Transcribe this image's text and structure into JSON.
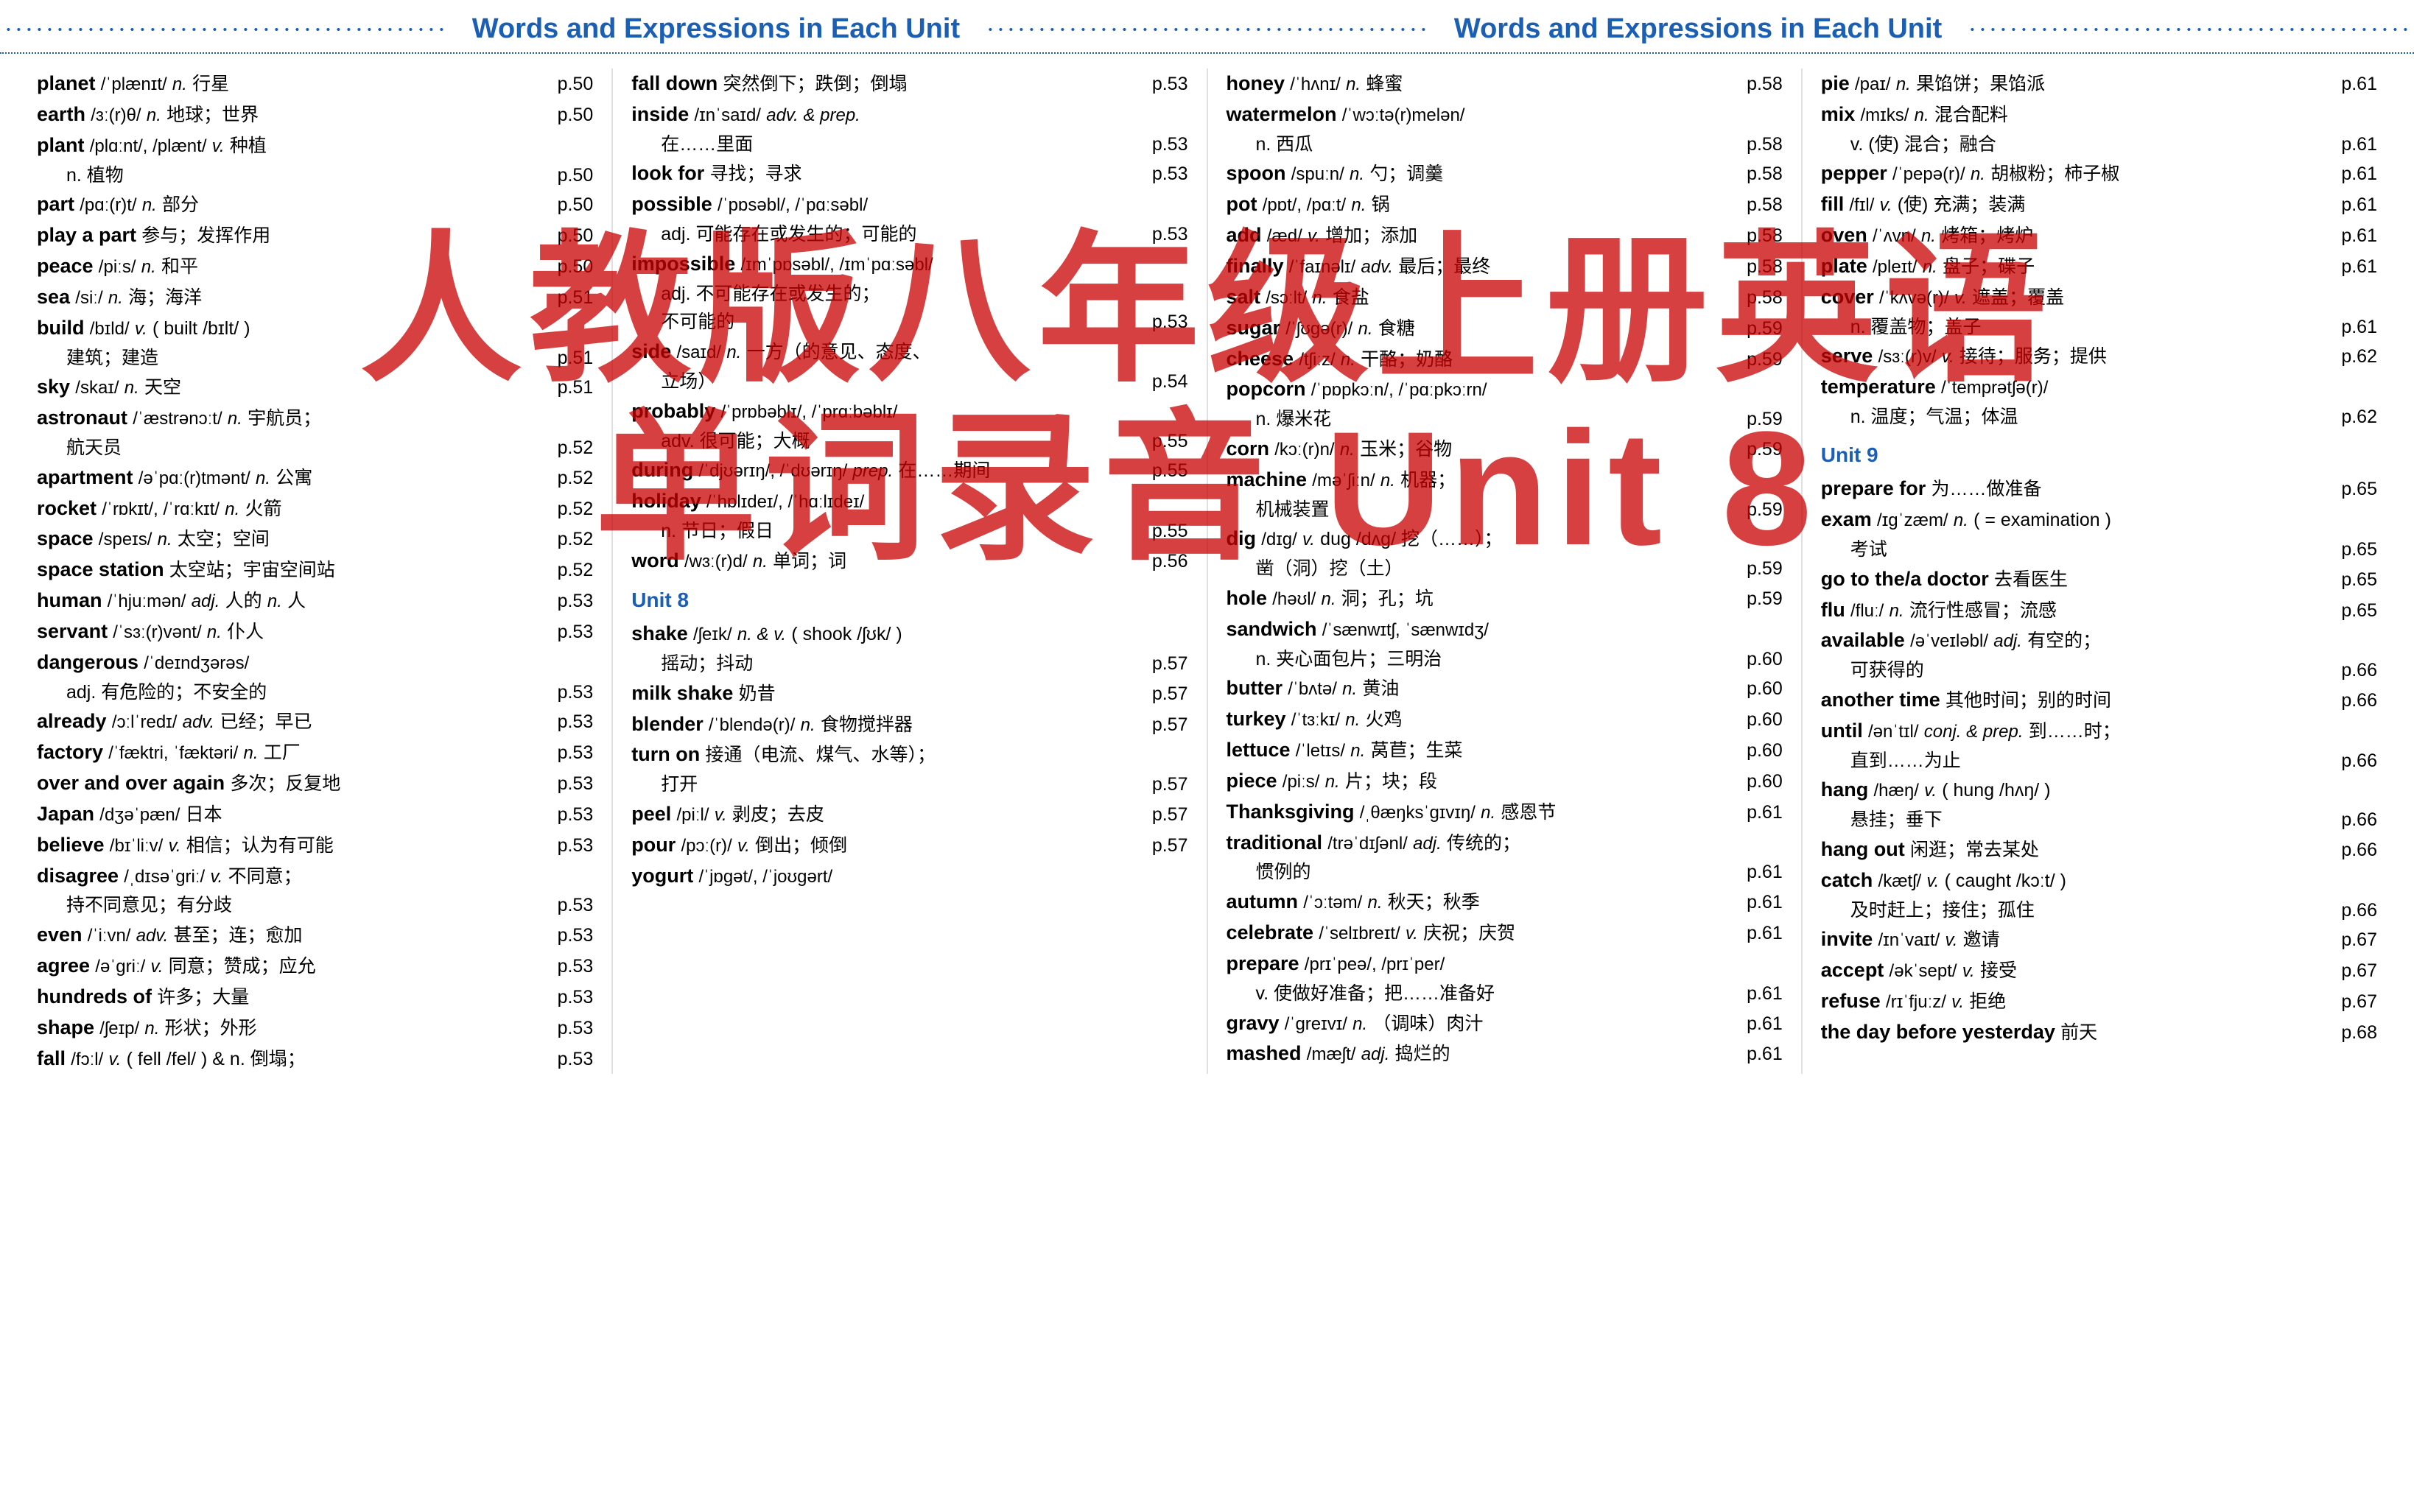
{
  "header": {
    "title": "Words and Expressions in Each Unit",
    "title2": "Words and Expressions in Each Unit"
  },
  "watermark": {
    "lines": [
      "人教版八年级上册英语",
      "单词录音 Unit 8"
    ]
  },
  "left_column": {
    "entries": [
      {
        "word": "planet",
        "phonetic": "/ˈplænɪt/",
        "pos": "n.",
        "meaning": "行星",
        "page": "p.50"
      },
      {
        "word": "earth",
        "phonetic": "/ɜː(r)θ/",
        "pos": "n.",
        "meaning": "地球；世界",
        "page": "p.50"
      },
      {
        "word": "plant",
        "phonetic": "/plɑːnt/, /plænt/",
        "pos": "v.",
        "meaning": "种植",
        "page": ""
      },
      {
        "indent": "n. 植物",
        "page": "p.50"
      },
      {
        "word": "part",
        "phonetic": "/pɑː(r)t/",
        "pos": "n.",
        "meaning": "部分",
        "page": "p.50"
      },
      {
        "word": "play a part",
        "meaning": "参与；发挥作用",
        "page": "p.50"
      },
      {
        "word": "peace",
        "phonetic": "/piːs/",
        "pos": "n.",
        "meaning": "和平",
        "page": "p.50"
      },
      {
        "word": "sea",
        "phonetic": "/siː/",
        "pos": "n.",
        "meaning": "海；海洋",
        "page": "p.51"
      },
      {
        "word": "build",
        "phonetic": "/bɪld/",
        "pos": "v.",
        "meaning": "( built /bɪlt/ )",
        "page": ""
      },
      {
        "indent": "建筑；建造",
        "page": "p.51"
      },
      {
        "word": "sky",
        "phonetic": "/skaɪ/",
        "pos": "n.",
        "meaning": "天空",
        "page": "p.51"
      },
      {
        "word": "astronaut",
        "phonetic": "/ˈæstrənɔːt/",
        "pos": "n.",
        "meaning": "宇航员；",
        "page": ""
      },
      {
        "indent": "航天员",
        "page": "p.52"
      },
      {
        "word": "apartment",
        "phonetic": "/əˈpɑː(r)tmənt/",
        "pos": "n.",
        "meaning": "公寓",
        "page": "p.52"
      },
      {
        "word": "rocket",
        "phonetic": "/ˈrɒkɪt/, /ˈrɑːkɪt/",
        "pos": "n.",
        "meaning": "火箭",
        "page": "p.52"
      },
      {
        "word": "space",
        "phonetic": "/speɪs/",
        "pos": "n.",
        "meaning": "太空；空间",
        "page": "p.52"
      },
      {
        "word": "space station",
        "meaning": "太空站；宇宙空间站",
        "page": "p.52"
      },
      {
        "word": "human",
        "phonetic": "/ˈhjuːmən/",
        "pos": "adj.",
        "meaning": "人的",
        "pos2": "n.",
        "meaning2": "人",
        "page": "p.53"
      },
      {
        "word": "servant",
        "phonetic": "/ˈsɜː(r)vənt/",
        "pos": "n.",
        "meaning": "仆人",
        "page": "p.53"
      },
      {
        "word": "dangerous",
        "phonetic": "/ˈdeɪndʒərəs/",
        "page": ""
      },
      {
        "indent": "adj. 有危险的；不安全的",
        "page": "p.53"
      },
      {
        "word": "already",
        "phonetic": "/ɔːlˈredɪ/",
        "pos": "adv.",
        "meaning": "已经；早已",
        "page": "p.53"
      },
      {
        "word": "factory",
        "phonetic": "/ˈfæktri, ˈfæktəri/",
        "pos": "n.",
        "meaning": "工厂",
        "page": "p.53"
      },
      {
        "word": "over and over again",
        "meaning": "多次；反复地",
        "page": "p.53"
      },
      {
        "word": "Japan",
        "phonetic": "/dʒəˈpæn/",
        "meaning": "日本",
        "page": "p.53"
      },
      {
        "word": "believe",
        "phonetic": "/bɪˈliːv/",
        "pos": "v.",
        "meaning": "相信；认为有可能",
        "page": "p.53"
      },
      {
        "word": "disagree",
        "phonetic": "/ˌdɪsəˈɡriː/",
        "pos": "v.",
        "meaning": "不同意；",
        "page": ""
      },
      {
        "indent": "持不同意见；有分歧",
        "page": "p.53"
      },
      {
        "word": "even",
        "phonetic": "/ˈiːvn/",
        "pos": "adv.",
        "meaning": "甚至；连；愈加",
        "page": "p.53"
      },
      {
        "word": "agree",
        "phonetic": "/əˈɡriː/",
        "pos": "v.",
        "meaning": "同意；赞成；应允",
        "page": "p.53"
      },
      {
        "word": "hundreds of",
        "meaning": "许多；大量",
        "page": "p.53"
      },
      {
        "word": "shape",
        "phonetic": "/ʃeɪp/",
        "pos": "n.",
        "meaning": "形状；外形",
        "page": "p.53"
      },
      {
        "word": "fall",
        "phonetic": "/fɔːl/",
        "pos": "v.",
        "meaning": "( fell /fel/ ) & n. 倒塌；",
        "page": "p.53"
      }
    ]
  },
  "middle_column": {
    "entries": [
      {
        "word": "fall down",
        "meaning": "突然倒下；跌倒；倒塌",
        "page": "p.53"
      },
      {
        "word": "inside",
        "phonetic": "/ɪnˈsaɪd/",
        "pos": "adv. & prep.",
        "page": ""
      },
      {
        "indent": "在……里面",
        "page": "p.53"
      },
      {
        "word": "look for",
        "meaning": "寻找；寻求",
        "page": "p.53"
      },
      {
        "word": "possible",
        "phonetic": "/ˈpɒsəbl/, /ˈpɑːsəbl/",
        "page": ""
      },
      {
        "indent": "adj. 可能存在或发生的；可能的",
        "page": "p.53"
      },
      {
        "word": "impossible",
        "phonetic": "/ɪmˈpɒsəbl/, /ɪmˈpɑːsəbl/",
        "page": ""
      },
      {
        "indent": "adj. 不可能存在或发生的；",
        "page": ""
      },
      {
        "indent": "不可能的",
        "page": "p.53"
      },
      {
        "word": "side",
        "phonetic": "/saɪd/",
        "pos": "n.",
        "meaning": "一方（的意见、态度、",
        "page": ""
      },
      {
        "indent": "立场）",
        "page": "p.54"
      },
      {
        "word": "probably",
        "phonetic": "/ˈprɒbəblɪ/, /ˈprɑːbəblɪ/",
        "page": ""
      },
      {
        "indent": "adv. 很可能；大概",
        "page": "p.55"
      },
      {
        "word": "during",
        "phonetic": "/ˈdjʊərɪŋ/, /ˈdʊərɪŋ/",
        "pos": "prep.",
        "meaning": "在……期间",
        "page": "p.55"
      },
      {
        "word": "holiday",
        "phonetic": "/ˈhɒlɪdeɪ/, /ˈhɑːlɪdeɪ/",
        "page": ""
      },
      {
        "indent": "n. 节日；假日",
        "page": "p.55"
      },
      {
        "word": "word",
        "phonetic": "/wɜː(r)d/",
        "pos": "n.",
        "meaning": "单词；词",
        "page": "p.56"
      },
      {
        "unit": "Unit 8"
      },
      {
        "word": "shake",
        "phonetic": "/ʃeɪk/",
        "pos": "n. & v.",
        "meaning": "( shook /ʃʊk/ )",
        "page": ""
      },
      {
        "indent": "摇动；抖动",
        "page": "p.57"
      },
      {
        "word": "milk shake",
        "meaning": "奶昔",
        "page": "p.57"
      },
      {
        "word": "blender",
        "phonetic": "/ˈblendə(r)/",
        "pos": "n.",
        "meaning": "食物搅拌器",
        "page": "p.57"
      },
      {
        "word": "turn on",
        "meaning": "接通（电流、煤气、水等）；",
        "page": ""
      },
      {
        "indent": "打开",
        "page": "p.57"
      },
      {
        "word": "peel",
        "phonetic": "/piːl/",
        "pos": "v.",
        "meaning": "剥皮；去皮",
        "page": "p.57"
      },
      {
        "word": "pour",
        "phonetic": "/pɔː(r)/",
        "pos": "v.",
        "meaning": "倒出；倾倒",
        "page": "p.57"
      },
      {
        "word": "yogurt",
        "phonetic": "/ˈjɒɡət/, /ˈjoʊɡərt/",
        "page": ""
      }
    ]
  },
  "right_column1": {
    "entries": [
      {
        "word": "honey",
        "phonetic": "/ˈhʌnɪ/",
        "pos": "n.",
        "meaning": "蜂蜜",
        "page": "p.58"
      },
      {
        "word": "watermelon",
        "phonetic": "/ˈwɔːtə(r)melən/",
        "page": ""
      },
      {
        "indent": "n. 西瓜",
        "page": "p.58"
      },
      {
        "word": "spoon",
        "phonetic": "/spuːn/",
        "pos": "n.",
        "meaning": "勺；调羹",
        "page": "p.58"
      },
      {
        "word": "pot",
        "phonetic": "/pɒt/, /pɑːt/",
        "pos": "n.",
        "meaning": "锅",
        "page": "p.58"
      },
      {
        "word": "add",
        "phonetic": "/æd/",
        "pos": "v.",
        "meaning": "增加；添加",
        "page": "p.58"
      },
      {
        "word": "finally",
        "phonetic": "/ˈfaɪnəlɪ/",
        "pos": "adv.",
        "meaning": "最后；最终",
        "page": "p.58"
      },
      {
        "word": "salt",
        "phonetic": "/sɔːlt/",
        "pos": "n.",
        "meaning": "食盐",
        "page": "p.58"
      },
      {
        "word": "sugar",
        "phonetic": "/ˈʃʊɡə(r)/",
        "pos": "n.",
        "meaning": "食糖",
        "page": "p.59"
      },
      {
        "word": "cheese",
        "phonetic": "/tʃiːz/",
        "pos": "n.",
        "meaning": "干酪；奶酪",
        "page": "p.59"
      },
      {
        "word": "popcorn",
        "phonetic": "/ˈpɒpkɔːn/, /ˈpɑːpkɔːrn/",
        "page": ""
      },
      {
        "indent": "n. 爆米花",
        "page": "p.59"
      },
      {
        "word": "corn",
        "phonetic": "/kɔː(r)n/",
        "pos": "n.",
        "meaning": "玉米；谷物",
        "page": "p.59"
      },
      {
        "word": "machine",
        "phonetic": "/məˈʃiːn/",
        "pos": "n.",
        "meaning": "机器；",
        "page": ""
      },
      {
        "indent": "机械装置",
        "page": "p.59"
      },
      {
        "word": "dig",
        "phonetic": "/dɪɡ/",
        "pos": "v.",
        "meaning": "dug /dʌɡ/  挖（……）；",
        "page": ""
      },
      {
        "indent": "凿（洞）挖（土）",
        "page": "p.59"
      },
      {
        "word": "hole",
        "phonetic": "/həʊl/",
        "pos": "n.",
        "meaning": "洞；孔；坑",
        "page": "p.59"
      },
      {
        "word": "sandwich",
        "phonetic": "/ˈsænwɪtʃ, ˈsænwɪdʒ/",
        "page": ""
      },
      {
        "indent": "n. 夹心面包片；三明治",
        "page": "p.60"
      },
      {
        "word": "butter",
        "phonetic": "/ˈbʌtə/",
        "pos": "n.",
        "meaning": "黄油",
        "page": "p.60"
      },
      {
        "word": "turkey",
        "phonetic": "/ˈtɜːkɪ/",
        "pos": "n.",
        "meaning": "火鸡",
        "page": "p.60"
      },
      {
        "word": "lettuce",
        "phonetic": "/ˈletɪs/",
        "pos": "n.",
        "meaning": "莴苣；生菜",
        "page": "p.60"
      },
      {
        "word": "piece",
        "phonetic": "/piːs/",
        "pos": "n.",
        "meaning": "片；块；段",
        "page": "p.60"
      },
      {
        "word": "Thanksgiving",
        "phonetic": "/ˌθæŋksˈɡɪvɪŋ/",
        "pos": "n.",
        "meaning": "感恩节",
        "page": "p.61"
      },
      {
        "word": "traditional",
        "phonetic": "/trəˈdɪʃənl/",
        "pos": "adj.",
        "meaning": "传统的；",
        "page": ""
      },
      {
        "indent": "惯例的",
        "page": "p.61"
      },
      {
        "word": "autumn",
        "phonetic": "/ˈɔːtəm/",
        "pos": "n.",
        "meaning": "秋天；秋季",
        "page": "p.61"
      },
      {
        "word": "celebrate",
        "phonetic": "/ˈselɪbreɪt/",
        "pos": "v.",
        "meaning": "庆祝；庆贺",
        "page": "p.61"
      },
      {
        "word": "prepare",
        "phonetic": "/prɪˈpeə/, /prɪˈper/",
        "page": ""
      },
      {
        "indent": "v. 使做好准备；把……准备好",
        "page": "p.61"
      },
      {
        "word": "gravy",
        "phonetic": "/ˈɡreɪvɪ/",
        "pos": "n.",
        "meaning": "（调味）肉汁",
        "page": "p.61"
      },
      {
        "word": "mashed",
        "phonetic": "/mæʃt/",
        "pos": "adj.",
        "meaning": "捣烂的",
        "page": "p.61"
      }
    ]
  },
  "right_column2": {
    "entries": [
      {
        "word": "pie",
        "phonetic": "/paɪ/",
        "pos": "n.",
        "meaning": "果馅饼；果馅派",
        "page": "p.61"
      },
      {
        "word": "mix",
        "phonetic": "/mɪks/",
        "pos": "n.",
        "meaning": "混合配料",
        "page": ""
      },
      {
        "indent": "v. (使) 混合；融合",
        "page": "p.61"
      },
      {
        "word": "pepper",
        "phonetic": "/ˈpepə(r)/",
        "pos": "n.",
        "meaning": "胡椒粉；柿子椒",
        "page": "p.61"
      },
      {
        "word": "fill",
        "phonetic": "/fɪl/",
        "pos": "v.",
        "meaning": "(使) 充满；装满",
        "page": "p.61"
      },
      {
        "word": "oven",
        "phonetic": "/ˈʌvn/",
        "pos": "n.",
        "meaning": "烤箱；烤炉",
        "page": "p.61"
      },
      {
        "word": "plate",
        "phonetic": "/pleɪt/",
        "pos": "n.",
        "meaning": "盘子；碟子",
        "page": "p.61"
      },
      {
        "word": "cover",
        "phonetic": "/ˈkʌvə(r)/",
        "pos": "v.",
        "meaning": "遮盖；覆盖",
        "page": ""
      },
      {
        "indent": "n. 覆盖物；盖子",
        "page": "p.61"
      },
      {
        "word": "serve",
        "phonetic": "/sɜː(r)v/",
        "pos": "v.",
        "meaning": "接待；服务；提供",
        "page": "p.62"
      },
      {
        "word": "temperature",
        "phonetic": "/ˈtemprətʃə(r)/",
        "page": ""
      },
      {
        "indent": "n. 温度；气温；体温",
        "page": "p.62"
      },
      {
        "unit": "Unit 9"
      },
      {
        "word": "prepare for",
        "meaning": "为……做准备",
        "page": "p.65"
      },
      {
        "word": "exam",
        "phonetic": "/ɪɡˈzæm/",
        "pos": "n.",
        "meaning": "( = examination )",
        "page": ""
      },
      {
        "indent": "考试",
        "page": "p.65"
      },
      {
        "word": "go to the/a doctor",
        "meaning": "去看医生",
        "page": "p.65"
      },
      {
        "word": "flu",
        "phonetic": "/fluː/",
        "pos": "n.",
        "meaning": "流行性感冒；流感",
        "page": "p.65"
      },
      {
        "word": "available",
        "phonetic": "/əˈveɪləbl/",
        "pos": "adj.",
        "meaning": "有空的；",
        "page": ""
      },
      {
        "indent": "可获得的",
        "page": "p.66"
      },
      {
        "word": "another time",
        "meaning": "其他时间；别的时间",
        "page": "p.66"
      },
      {
        "word": "until",
        "phonetic": "/ənˈtɪl/",
        "pos": "conj. & prep.",
        "meaning": "到……时；",
        "page": ""
      },
      {
        "indent": "直到……为止",
        "page": "p.66"
      },
      {
        "word": "hang",
        "phonetic": "/hæŋ/",
        "pos": "v.",
        "meaning": "( hung /hʌŋ/ )",
        "page": ""
      },
      {
        "indent": "悬挂；垂下",
        "page": "p.66"
      },
      {
        "word": "hang out",
        "meaning": "闲逛；常去某处",
        "page": "p.66"
      },
      {
        "word": "catch",
        "phonetic": "/kætʃ/",
        "pos": "v.",
        "meaning": "( caught /kɔːt/ )",
        "page": ""
      },
      {
        "indent": "及时赶上；接住；孤住",
        "page": "p.66"
      },
      {
        "word": "invite",
        "phonetic": "/ɪnˈvaɪt/",
        "pos": "v.",
        "meaning": "邀请",
        "page": "p.67"
      },
      {
        "word": "accept",
        "phonetic": "/əkˈsept/",
        "pos": "v.",
        "meaning": "接受",
        "page": "p.67"
      },
      {
        "word": "refuse",
        "phonetic": "/rɪˈfjuːz/",
        "pos": "v.",
        "meaning": "拒绝",
        "page": "p.67"
      },
      {
        "word": "the day before yesterday",
        "meaning": "前天",
        "page": "p.68"
      }
    ]
  }
}
